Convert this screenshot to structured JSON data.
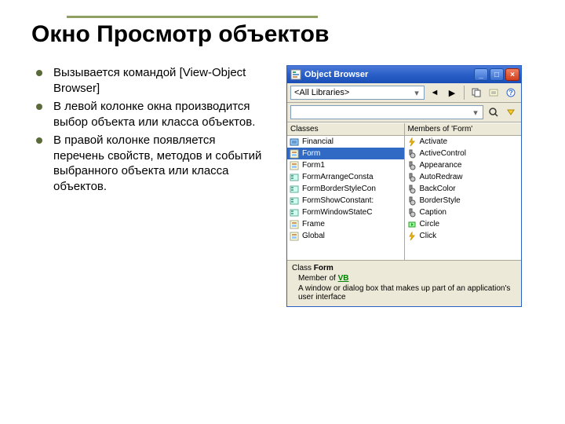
{
  "slide": {
    "title": "Окно Просмотр объектов",
    "bullets": [
      "Вызывается командой [View-Object Browser]",
      "В левой колонке окна производится выбор объекта или класса объектов.",
      "В правой колонке появляется перечень свойств, методов и событий выбранного объекта или класса объектов."
    ]
  },
  "window": {
    "title": "Object Browser",
    "library_combo": "<All Libraries>",
    "search_combo": "",
    "nav_back": "◄",
    "nav_fwd": "▶",
    "classes_header": "Classes",
    "members_header": "Members of 'Form'",
    "classes": [
      {
        "name": "Financial",
        "kind": "module"
      },
      {
        "name": "Form",
        "kind": "class",
        "selected": true
      },
      {
        "name": "Form1",
        "kind": "class"
      },
      {
        "name": "FormArrangeConsta",
        "kind": "enum"
      },
      {
        "name": "FormBorderStyleCon",
        "kind": "enum"
      },
      {
        "name": "FormShowConstant:",
        "kind": "enum"
      },
      {
        "name": "FormWindowStateC",
        "kind": "enum"
      },
      {
        "name": "Frame",
        "kind": "class"
      },
      {
        "name": "Global",
        "kind": "class"
      }
    ],
    "members": [
      {
        "name": "Activate",
        "kind": "event"
      },
      {
        "name": "ActiveControl",
        "kind": "prop"
      },
      {
        "name": "Appearance",
        "kind": "prop"
      },
      {
        "name": "AutoRedraw",
        "kind": "prop"
      },
      {
        "name": "BackColor",
        "kind": "prop"
      },
      {
        "name": "BorderStyle",
        "kind": "prop"
      },
      {
        "name": "Caption",
        "kind": "prop"
      },
      {
        "name": "Circle",
        "kind": "method"
      },
      {
        "name": "Click",
        "kind": "event"
      }
    ],
    "info": {
      "class_label": "Class",
      "class_name": "Form",
      "member_label": "Member of",
      "member_link": "VB",
      "description": "A window or dialog box that makes up part of an application's user interface"
    }
  }
}
